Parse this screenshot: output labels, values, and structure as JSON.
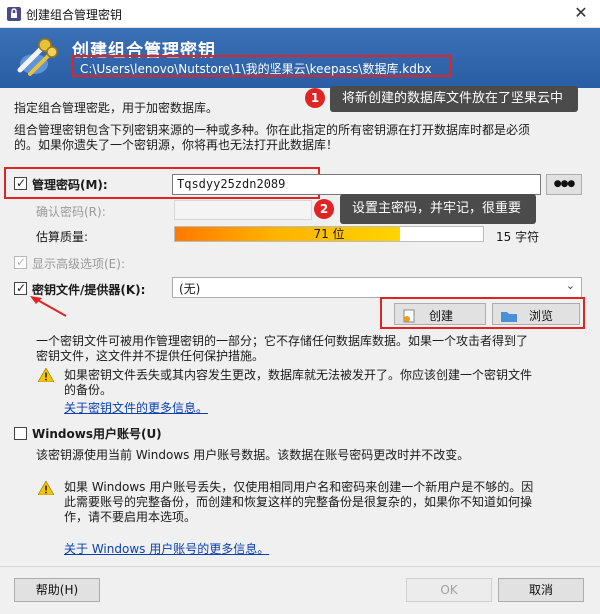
{
  "window": {
    "title": "创建组合管理密钥",
    "close_symbol": "✕",
    "icon": "keepass-lock-icon"
  },
  "banner": {
    "title": "创建组合管理密钥",
    "path": "C:\\Users\\lenovo\\Nutstore\\1\\我的坚果云\\keepass\\数据库.kdbx",
    "icon": "keys-icon"
  },
  "intro": {
    "line1": "指定组合管理密匙，用于加密数据库。",
    "line2": "组合管理密钥包含下列密钥来源的一种或多种。你在此指定的所有密钥源在打开数据库时都是必须",
    "line3": "的。如果你遗失了一个密钥源，你将再也无法打开此数据库！"
  },
  "callouts": [
    {
      "num": "1",
      "text": "将新创建的数据库文件放在了坚果云中"
    },
    {
      "num": "2",
      "text": "设置主密码，并牢记，很重要"
    }
  ],
  "master_password": {
    "label": "管理密码(M):",
    "value": "Tqsdyy25zdn2089",
    "reveal_button": "●●●",
    "confirm_label": "确认密码(R):",
    "quality_label": "估算质量:",
    "quality_text": "71 位",
    "quality_bits": 71,
    "quality_fraction": 0.73,
    "char_count": "15 字符",
    "show_advanced": "显示高级选项(E):"
  },
  "key_file": {
    "label": "密钥文件/提供器(K):",
    "selected": "(无)",
    "create_button": "创建",
    "browse_button": "浏览",
    "desc1": "一个密钥文件可被用作管理密钥的一部分；它不存储任何数据库数据。如果一个攻击者得到了",
    "desc2": "密钥文件，这文件并不提供任何保护措施。",
    "warn1": "如果密钥文件丢失或其内容发生更改，数据库就无法被发开了。你应该创建一个密钥文件",
    "warn2": "的备份。",
    "more_link": "关于密钥文件的更多信息。"
  },
  "windows_account": {
    "label": "Windows用户账号(U)",
    "desc": "该密钥源使用当前 Windows 用户账号数据。该数据在账号密码更改时并不改变。",
    "warn1": "如果 Windows 用户账号丢失，仅使用相同用户名和密码来创建一个新用户是不够的。因",
    "warn2": "此需要账号的完整备份，而创建和恢复这样的完整备份是很复杂的，如果你不知道如何操",
    "warn3": "作，请不要启用本选项。",
    "more_link": "关于 Windows 用户账号的更多信息。"
  },
  "footer": {
    "help": "帮助(H)",
    "ok": "OK",
    "cancel": "取消"
  },
  "colors": {
    "banner": "#2f64aa",
    "annotation_red": "#e02424",
    "callout_bg": "#4b4b4b"
  }
}
